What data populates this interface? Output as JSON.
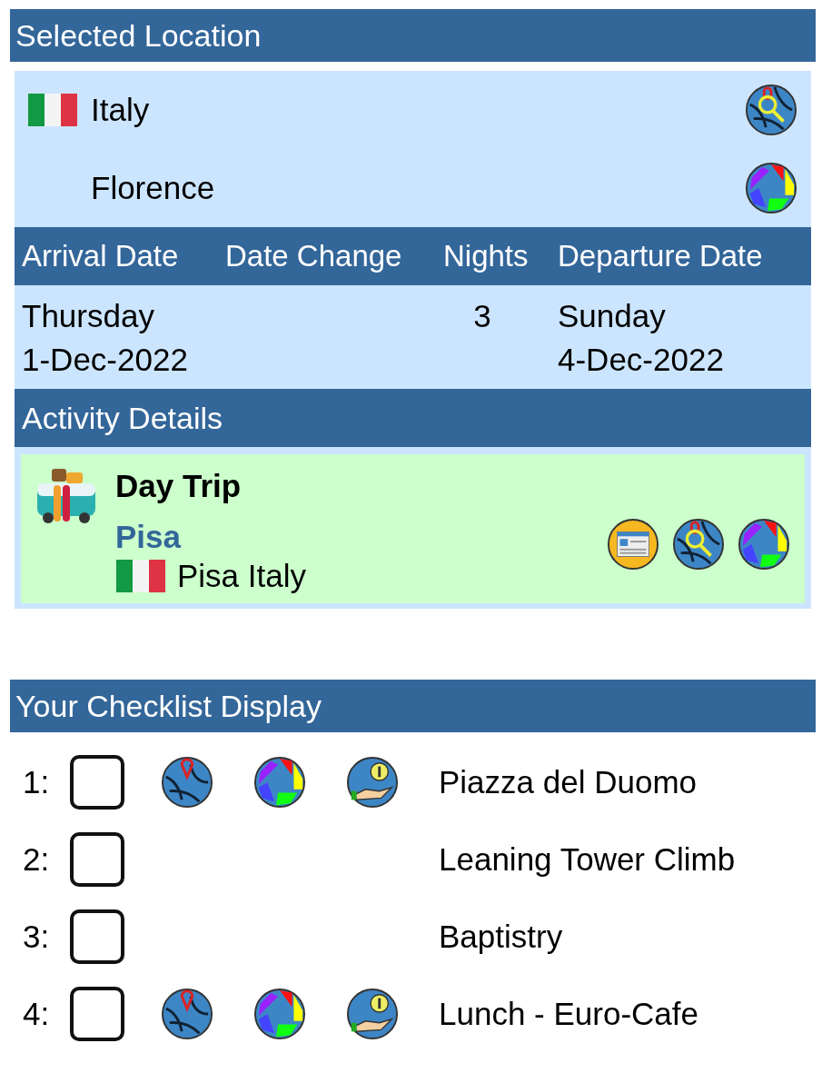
{
  "location": {
    "title": "Selected Location",
    "rows": [
      {
        "kind": "country",
        "label": "Italy"
      },
      {
        "kind": "city",
        "label": "Florence"
      }
    ]
  },
  "stay": {
    "columns": [
      "Arrival Date",
      "Date Change",
      "Nights",
      "Departure Date"
    ],
    "arrival": [
      "Thursday",
      "1-Dec-2022"
    ],
    "nights": "3",
    "departure": [
      "Sunday",
      "4-Dec-2022"
    ]
  },
  "activity": {
    "title": "Activity Details",
    "category": "Day Trip",
    "name": "Pisa",
    "place": "Pisa Italy"
  },
  "checklist": {
    "title": "Your Checklist Display",
    "items": [
      {
        "number": "1:",
        "checked": false,
        "links": true,
        "label": "Piazza del Duomo"
      },
      {
        "number": "2:",
        "checked": false,
        "links": false,
        "label": "Leaning Tower Climb"
      },
      {
        "number": "3:",
        "checked": false,
        "links": false,
        "label": "Baptistry"
      },
      {
        "number": "4:",
        "checked": false,
        "links": true,
        "label": "Lunch - Euro-Cafe"
      }
    ]
  }
}
